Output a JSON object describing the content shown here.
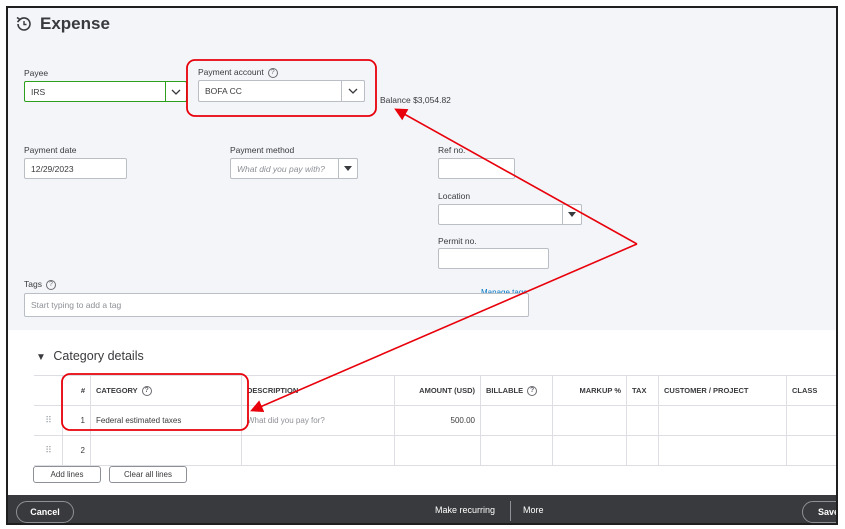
{
  "header": {
    "title": "Expense",
    "icon": "expense-clock-icon"
  },
  "payee": {
    "label": "Payee",
    "value": "IRS"
  },
  "payment_account": {
    "label": "Payment account",
    "value": "BOFA CC",
    "help": "?"
  },
  "balance": {
    "text": "Balance $3,054.82"
  },
  "payment_date": {
    "label": "Payment date",
    "value": "12/29/2023"
  },
  "payment_method": {
    "label": "Payment method",
    "placeholder": "What did you pay with?"
  },
  "ref_no": {
    "label": "Ref no.",
    "value": ""
  },
  "location": {
    "label": "Location",
    "value": ""
  },
  "permit_no": {
    "label": "Permit no.",
    "value": ""
  },
  "tags": {
    "label": "Tags",
    "help": "?",
    "placeholder": "Start typing to add a tag",
    "manage_link": "Manage tags"
  },
  "category_details": {
    "title": "Category details",
    "toggle": "▼",
    "headers": [
      "#",
      "CATEGORY",
      "DESCRIPTION",
      "AMOUNT (USD)",
      "BILLABLE",
      "MARKUP %",
      "TAX",
      "CUSTOMER / PROJECT",
      "CLASS"
    ],
    "rows": [
      {
        "num": "1",
        "category": "Federal estimated taxes",
        "description_placeholder": "What did you pay for?",
        "amount": "500.00"
      },
      {
        "num": "2",
        "category": "",
        "description_placeholder": "",
        "amount": ""
      }
    ],
    "add_lines": "Add lines",
    "clear_lines": "Clear all lines"
  },
  "footer": {
    "cancel": "Cancel",
    "make_recurring": "Make recurring",
    "more": "More",
    "save": "Save"
  },
  "colors": {
    "annotation": "#e8000b",
    "footer_bg": "#393a3d",
    "link": "#0077c5",
    "payee_border": "#2ca01c"
  }
}
